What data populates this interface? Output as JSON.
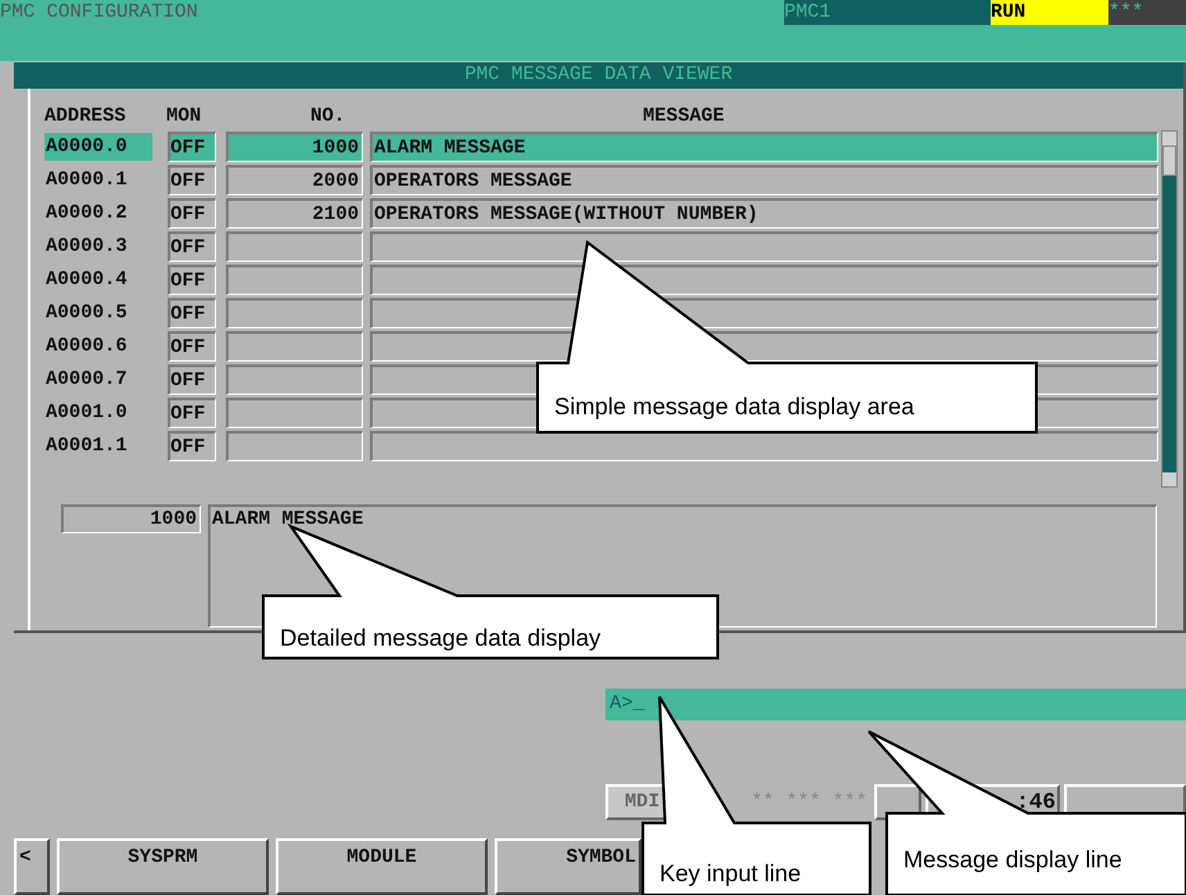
{
  "window": {
    "title": "PMC CONFIGURATION",
    "path": "PMC1",
    "run_state": "RUN",
    "alarm": "***"
  },
  "viewer": {
    "title": "PMC MESSAGE DATA VIEWER",
    "columns": [
      "ADDRESS",
      "MON",
      "NO.",
      "MESSAGE"
    ],
    "rows": [
      {
        "address": "A0000.0",
        "mon": "OFF",
        "no": "1000",
        "message": "ALARM MESSAGE",
        "selected": true
      },
      {
        "address": "A0000.1",
        "mon": "OFF",
        "no": "2000",
        "message": "OPERATORS MESSAGE",
        "selected": false
      },
      {
        "address": "A0000.2",
        "mon": "OFF",
        "no": "2100",
        "message": "OPERATORS MESSAGE(WITHOUT NUMBER)",
        "selected": false
      },
      {
        "address": "A0000.3",
        "mon": "OFF",
        "selected": false
      },
      {
        "address": "A0000.4",
        "mon": "OFF",
        "selected": false
      },
      {
        "address": "A0000.5",
        "mon": "OFF",
        "selected": false
      },
      {
        "address": "A0000.6",
        "mon": "OFF",
        "selected": false
      },
      {
        "address": "A0000.7",
        "mon": "OFF",
        "selected": false
      },
      {
        "address": "A0001.0",
        "mon": "OFF",
        "selected": false
      },
      {
        "address": "A0001.1",
        "mon": "OFF",
        "selected": false
      }
    ],
    "detail": {
      "no": "1000",
      "message": "ALARM MESSAGE"
    }
  },
  "key_input": {
    "value": "A>_"
  },
  "status_bar": {
    "mode": "MDI",
    "stars": "** *** ***",
    "time": ":46"
  },
  "soft_keys": [
    "<",
    "SYSPRM",
    "MODULE",
    "SYMBOL"
  ],
  "callouts": [
    {
      "text": "Simple message data display area"
    },
    {
      "text": "Detailed message data display"
    },
    {
      "text": "Key input line"
    },
    {
      "text": "Message display line"
    }
  ]
}
